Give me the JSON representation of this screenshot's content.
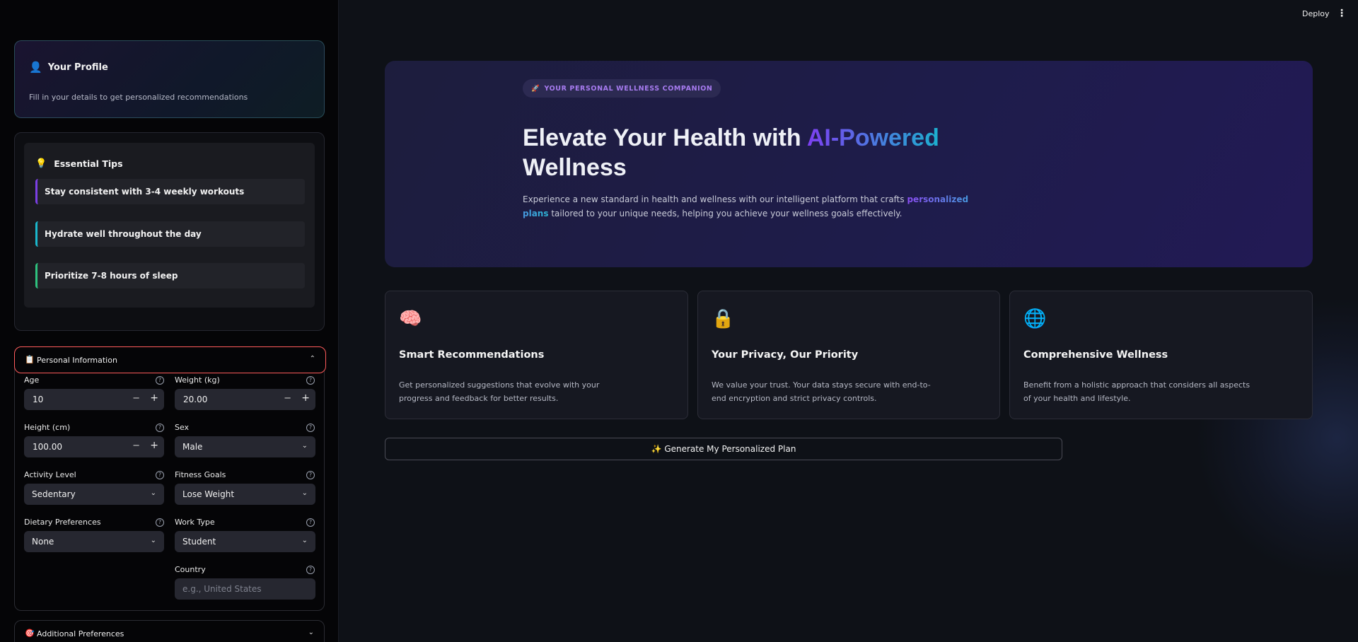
{
  "topbar": {
    "deploy_label": "Deploy",
    "menu_icon": "⋮"
  },
  "profile": {
    "icon": "👤",
    "title": "Your Profile",
    "subtitle": "Fill in your details to get personalized recommendations"
  },
  "tips": {
    "icon": "💡",
    "title": "Essential Tips",
    "items": [
      "Stay consistent with 3-4 weekly workouts",
      "Hydrate well throughout the day",
      "Prioritize 7-8 hours of sleep"
    ]
  },
  "personal": {
    "icon": "📋",
    "title": "Personal Information",
    "chevron": "⌃",
    "age": {
      "label": "Age",
      "value": "10"
    },
    "weight": {
      "label": "Weight (kg)",
      "value": "20.00"
    },
    "height": {
      "label": "Height (cm)",
      "value": "100.00"
    },
    "sex": {
      "label": "Sex",
      "value": "Male"
    },
    "activity": {
      "label": "Activity Level",
      "value": "Sedentary"
    },
    "goals": {
      "label": "Fitness Goals",
      "value": "Lose Weight"
    },
    "diet": {
      "label": "Dietary Preferences",
      "value": "None"
    },
    "work": {
      "label": "Work Type",
      "value": "Student"
    },
    "country": {
      "label": "Country",
      "placeholder": "e.g., United States"
    },
    "minus": "−",
    "plus": "+",
    "help": "?",
    "select_chevron": "⌄"
  },
  "additional": {
    "icon": "🎯",
    "title": "Additional Preferences",
    "chevron": "⌄"
  },
  "hero": {
    "badge_icon": "🚀",
    "badge": "YOUR PERSONAL WELLNESS COMPANION",
    "title_pre": "Elevate Your Health with ",
    "title_hl": "AI-Powered",
    "title_post": " Wellness",
    "desc_pre": "Experience a new standard in health and wellness with our intelligent platform that crafts ",
    "desc_hl": "personalized plans",
    "desc_post": " tailored to your unique needs, helping you achieve your wellness goals effectively."
  },
  "features": [
    {
      "icon": "🧠",
      "title": "Smart Recommendations",
      "desc": "Get personalized suggestions that evolve with your progress and feedback for better results."
    },
    {
      "icon": "🔒",
      "title": "Your Privacy, Our Priority",
      "desc": "We value your trust. Your data stays secure with end-to-end encryption and strict privacy controls."
    },
    {
      "icon": "🌐",
      "title": "Comprehensive Wellness",
      "desc": "Benefit from a holistic approach that considers all aspects of your health and lifestyle."
    }
  ],
  "generate_button": "✨ Generate My Personalized Plan"
}
